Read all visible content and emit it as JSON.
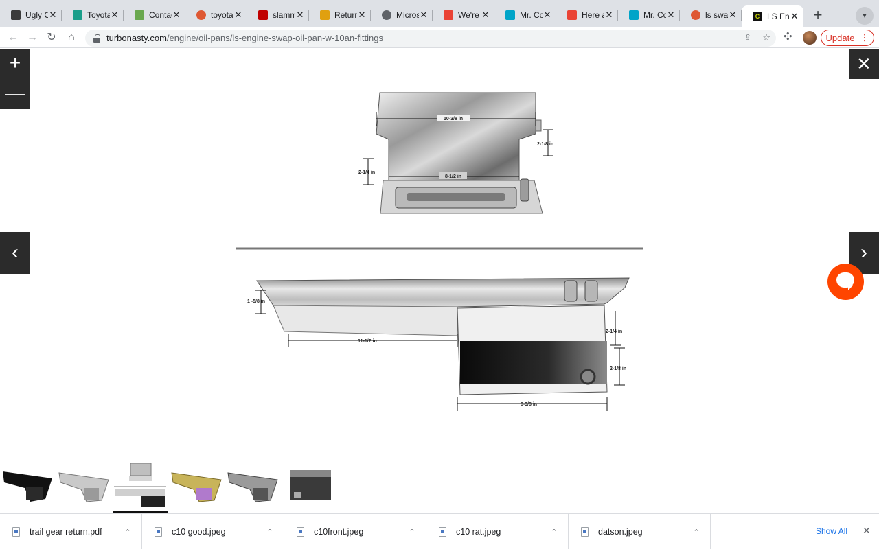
{
  "browser": {
    "tabs": [
      {
        "title": "Ugly C",
        "icon": "photo-favicon",
        "color": "#3b3b3b"
      },
      {
        "title": "Toyota",
        "icon": "forum-favicon",
        "color": "#1a9e8a"
      },
      {
        "title": "Contac",
        "icon": "leaf-favicon",
        "color": "#6aa84f"
      },
      {
        "title": "toyota",
        "icon": "duckduckgo-favicon",
        "color": "#de5833"
      },
      {
        "title": "slamm",
        "icon": "d-favicon",
        "color": "#c00000"
      },
      {
        "title": "Return",
        "icon": "tg-favicon",
        "color": "#e0a010"
      },
      {
        "title": "Micros",
        "icon": "globe-favicon",
        "color": "#5f6368"
      },
      {
        "title": "We're",
        "icon": "gmail-favicon",
        "color": "#ea4335"
      },
      {
        "title": "Mr. Co",
        "icon": "c-favicon",
        "color": "#00a4c8"
      },
      {
        "title": "Here a",
        "icon": "gmail-favicon",
        "color": "#ea4335"
      },
      {
        "title": "Mr. Co",
        "icon": "c-favicon",
        "color": "#00a4c8"
      },
      {
        "title": "ls swa",
        "icon": "duckduckgo-favicon",
        "color": "#de5833"
      },
      {
        "title": "LS Eng",
        "icon": "c-favicon",
        "color": "#c8d400",
        "active": true
      }
    ],
    "new_tab_symbol": "+",
    "tab_close_symbol": "✕",
    "url_host": "turbonasty.com",
    "url_path": "/engine/oil-pans/ls-engine-swap-oil-pan-w-10an-fittings",
    "update_label": "Update"
  },
  "viewer": {
    "zoom_in_symbol": "+",
    "zoom_out_symbol": "—",
    "close_symbol": "✕",
    "prev_symbol": "‹",
    "next_symbol": "›",
    "top_view_dims": {
      "top_width": "10-3/8 in",
      "right_height": "2-1/8 in",
      "left_height": "2-1/4 in",
      "bottom_width": "8-1/2 in"
    },
    "side_view_dims": {
      "left_height": "1 -5/8 in",
      "front_length": "11-1/2 in",
      "sump_upper": "2-1/4 in",
      "sump_lower": "2-1/8 in",
      "sump_width": "8-3/8 in"
    },
    "thumbnail_count": 6,
    "active_thumbnail": 3
  },
  "downloads": {
    "items": [
      {
        "name": "trail gear return.pdf"
      },
      {
        "name": "c10 good.jpeg"
      },
      {
        "name": "c10front.jpeg"
      },
      {
        "name": "c10 rat.jpeg"
      },
      {
        "name": "datson.jpeg"
      }
    ],
    "chevron_symbol": "⌃",
    "show_all_label": "Show All",
    "close_symbol": "✕"
  }
}
